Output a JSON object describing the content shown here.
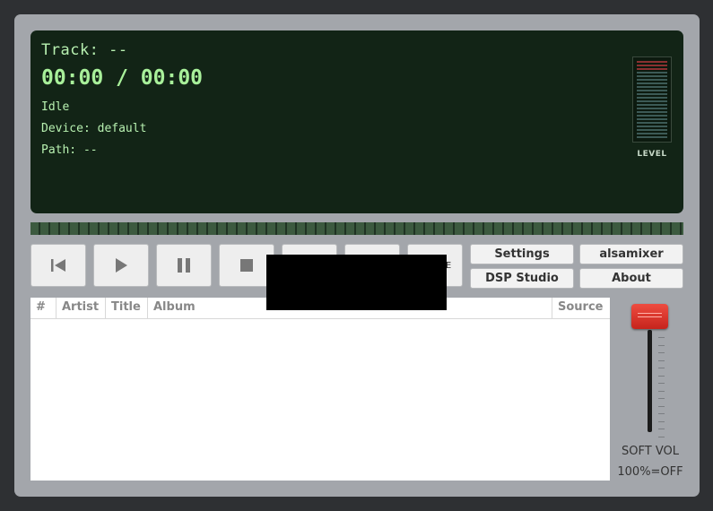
{
  "display": {
    "track": "Track: --",
    "time": "00:00 / 00:00",
    "status": "Idle",
    "device": "Device: default",
    "path": "Path: --",
    "level_label": "LEVEL",
    "level_icon": "level-meter-icon"
  },
  "transport": {
    "previous_icon": "skip-previous-icon",
    "play_icon": "play-icon",
    "pause_icon": "pause-icon",
    "stop_icon": "stop-icon",
    "partial_label": "E"
  },
  "panel_buttons": {
    "settings": "Settings",
    "alsamixer": "alsamixer",
    "dsp_studio": "DSP Studio",
    "about": "About"
  },
  "playlist": {
    "columns": [
      "#",
      "Artist",
      "Title",
      "Album",
      "Source"
    ],
    "rows": []
  },
  "volume": {
    "label": "SOFT VOL",
    "note": "100%=OFF",
    "level_fraction": 1.0
  },
  "colors": {
    "display_bg": "#122416",
    "display_text": "#b7f0b0",
    "knob": "#d8322a"
  }
}
